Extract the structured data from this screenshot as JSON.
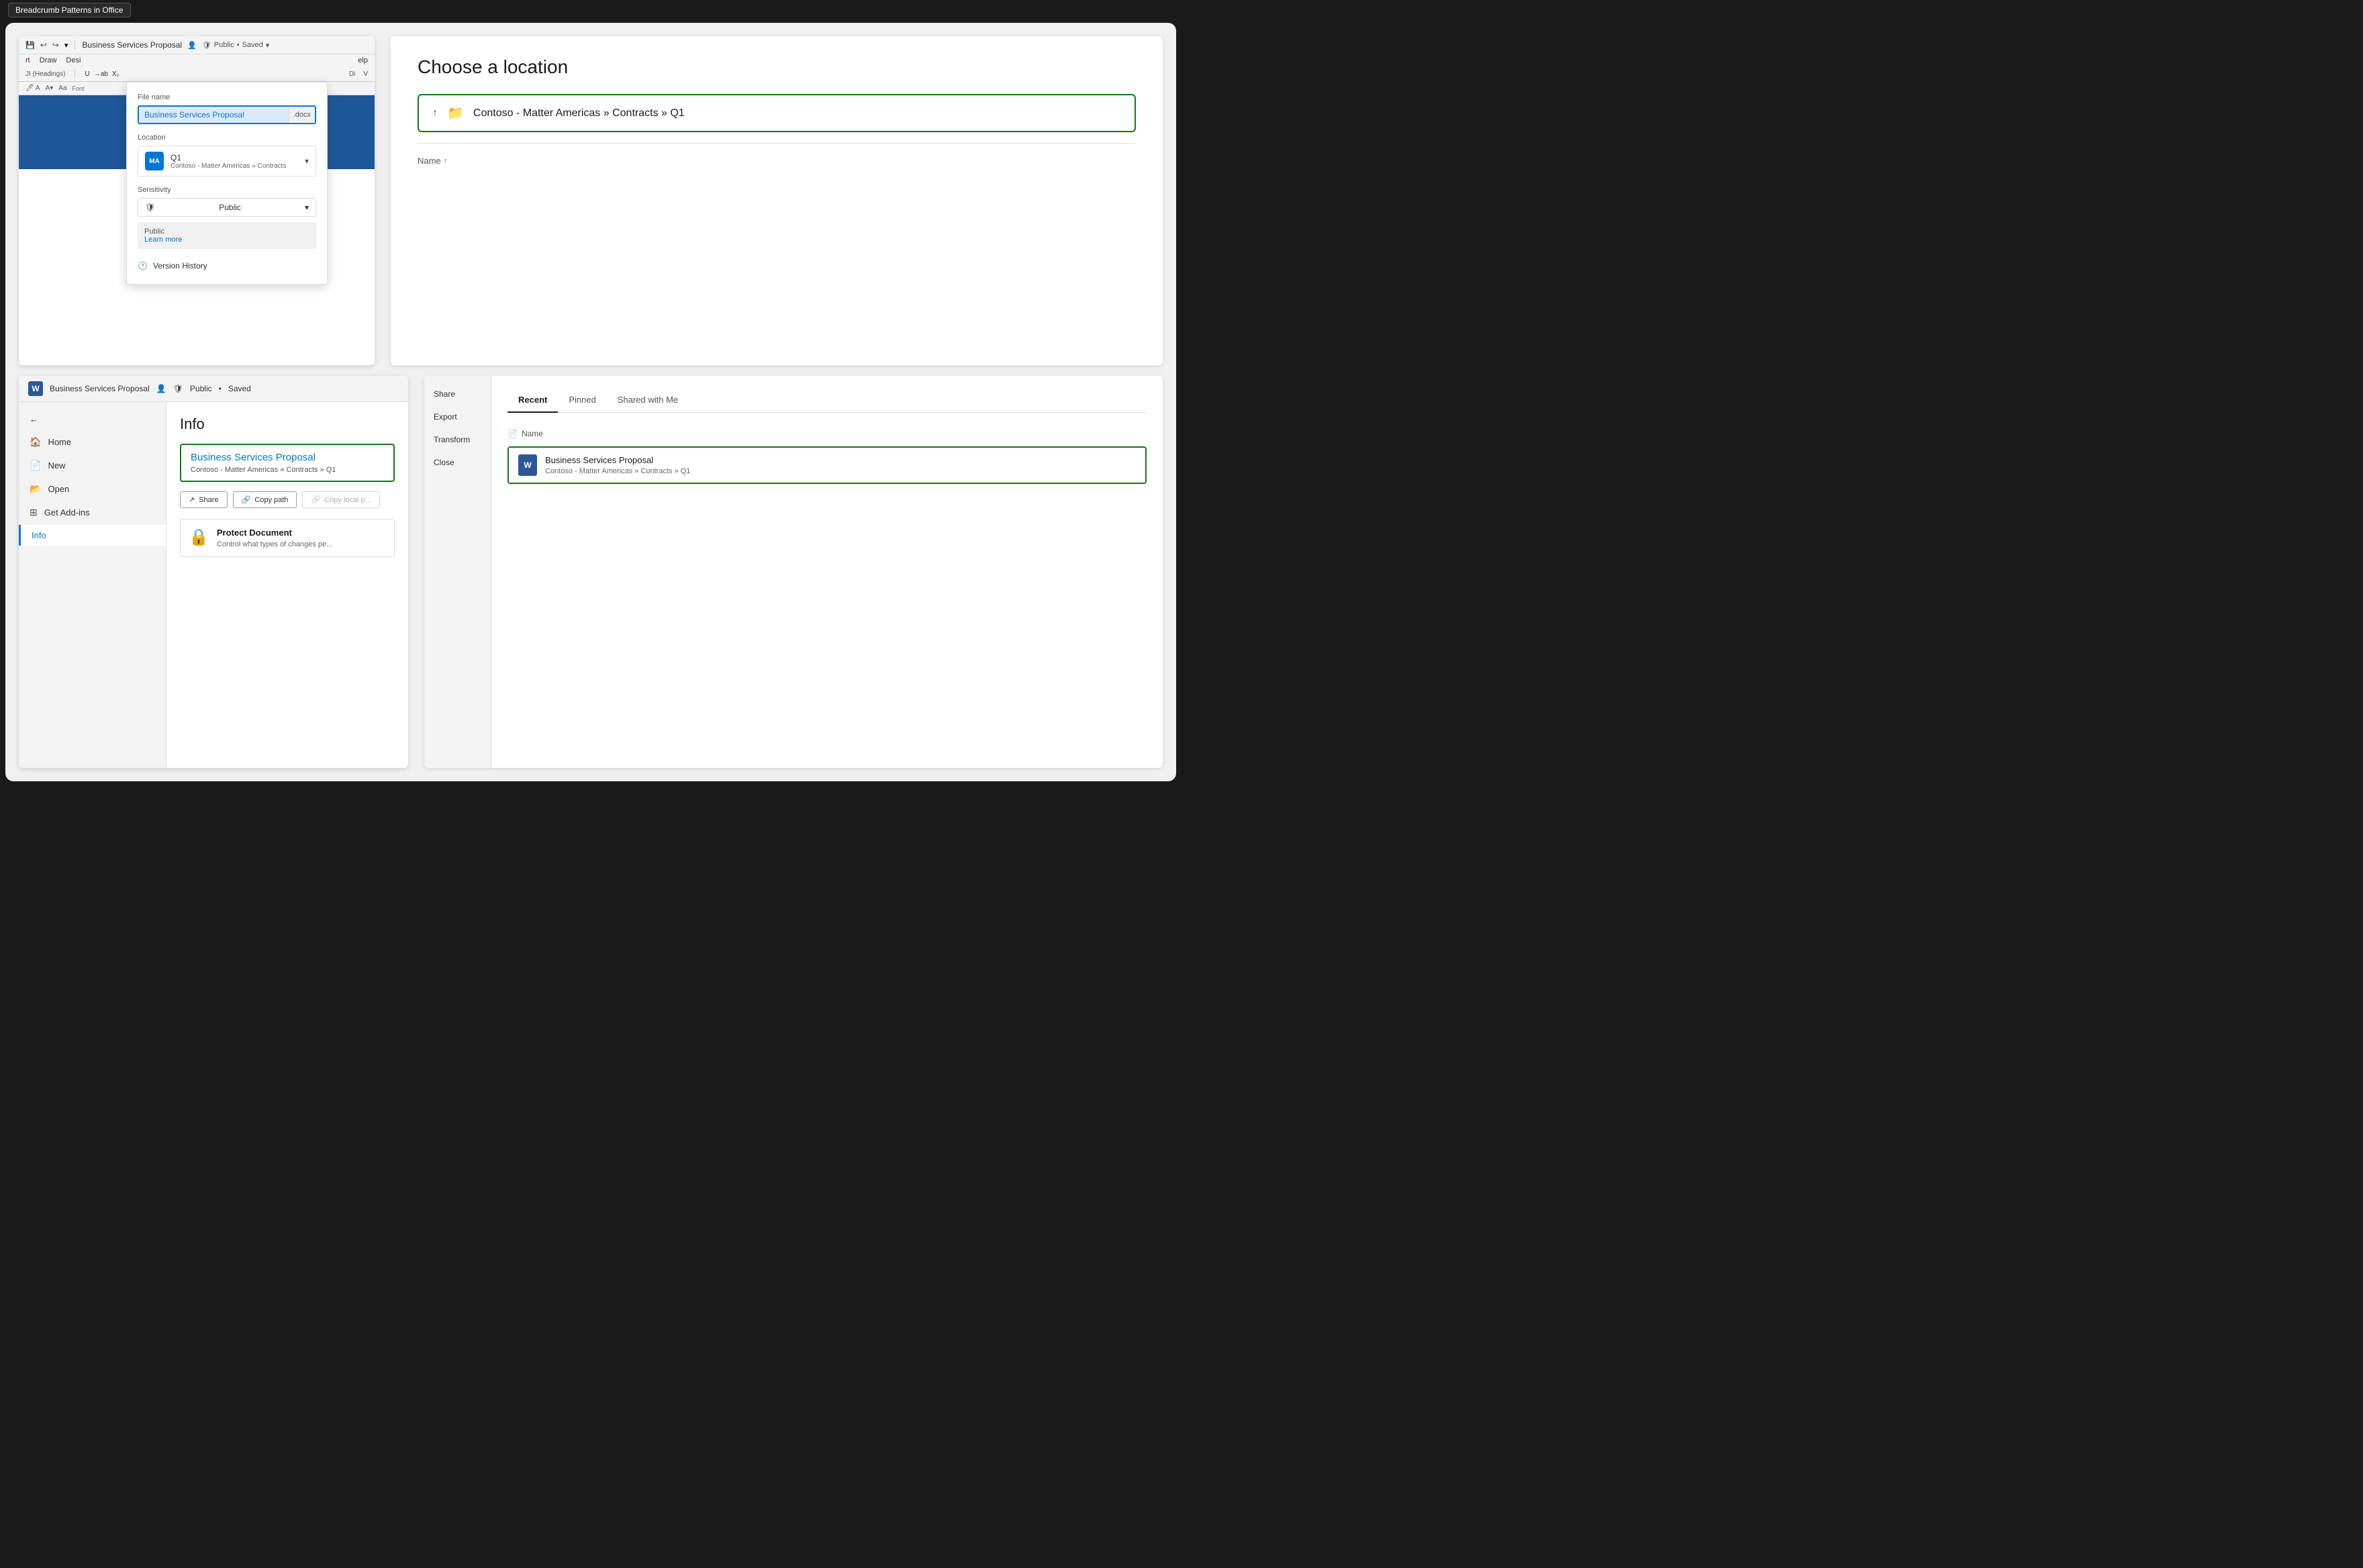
{
  "titleBar": {
    "label": "Breadcrumb Patterns in Office"
  },
  "topLeft": {
    "ribbon": {
      "filename": "Business Services Proposal",
      "statusPublic": "Public",
      "statusSaved": "Saved",
      "menuItems": [
        "rt",
        "Draw",
        "Desi",
        "elp"
      ]
    },
    "dropdown": {
      "fileNameLabel": "File name",
      "fileNameValue": "Business Services Proposal",
      "fileExtension": ".docx",
      "locationLabel": "Location",
      "locationAvatarText": "MA",
      "locationTitle": "Q1",
      "locationBreadcrumb": "Contoso - Matter Americas » Contracts",
      "sensitivityLabel": "Sensitivity",
      "sensitivityValue": "Public",
      "publicDescription": "Public",
      "learnMoreText": "Learn more",
      "versionHistoryText": "Version History"
    }
  },
  "topRight": {
    "title": "Choose a location",
    "locationPath": "Contoso - Matter Americas » Contracts » Q1",
    "nameColumnHeader": "Name"
  },
  "bottomLeft": {
    "titleBar": {
      "filename": "Business Services Proposal",
      "statusPublic": "Public",
      "statusSaved": "Saved"
    },
    "navItems": [
      {
        "label": "Home",
        "icon": "🏠"
      },
      {
        "label": "New",
        "icon": "📄"
      },
      {
        "label": "Open",
        "icon": "📂"
      },
      {
        "label": "Get Add-ins",
        "icon": "⊞"
      },
      {
        "label": "Info",
        "icon": "",
        "active": true
      }
    ],
    "content": {
      "title": "Info",
      "docTitle": "Business Services Proposal",
      "docBreadcrumb": "Contoso - Matter Americas » Contracts » Q1",
      "shareBtn": "Share",
      "copyPathBtn": "Copy path",
      "copyLocalBtn": "Copy local p...",
      "protectTitle": "Protect Document",
      "protectDesc": "Control what types of changes pe..."
    }
  },
  "bottomRight": {
    "sidebarItems": [
      "Share",
      "Export",
      "Transform",
      "Close"
    ],
    "tabs": [
      "Recent",
      "Pinned",
      "Shared with Me"
    ],
    "activeTab": "Recent",
    "nameColumnHeader": "Name",
    "recentFile": {
      "name": "Business Services Proposal",
      "path": "Contoso - Matter Americas » Contracts » Q1"
    }
  }
}
